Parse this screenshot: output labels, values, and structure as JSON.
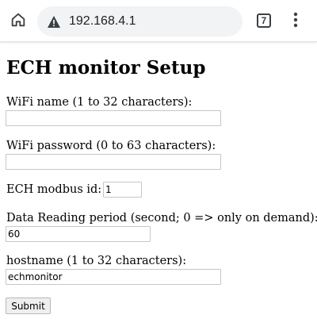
{
  "browser": {
    "url": "192.168.4.1",
    "tab_count": "7",
    "icons": {
      "home": "home-icon",
      "security": "not-secure-warning-icon",
      "tabs": "tab-switcher-icon",
      "menu": "more-vert-icon"
    }
  },
  "page": {
    "title": "ECH monitor Setup",
    "form": {
      "wifi_name": {
        "label": "WiFi name (1 to 32 characters):",
        "value": ""
      },
      "wifi_password": {
        "label": "WiFi password (0 to 63 characters):",
        "value": ""
      },
      "modbus_id": {
        "label": "ECH modbus id:",
        "value": "1"
      },
      "reading_period": {
        "label": "Data Reading period (second; 0 => only on demand):",
        "value": "60"
      },
      "hostname": {
        "label": "hostname (1 to 32 characters):",
        "value": "echmonitor"
      },
      "submit_label": "Submit"
    }
  },
  "colors": {
    "omnibox_background": "#f1f3f4",
    "chrome_icon": "#3c4043",
    "input_border": "#c7c7c7",
    "button_background": "#efefef"
  }
}
